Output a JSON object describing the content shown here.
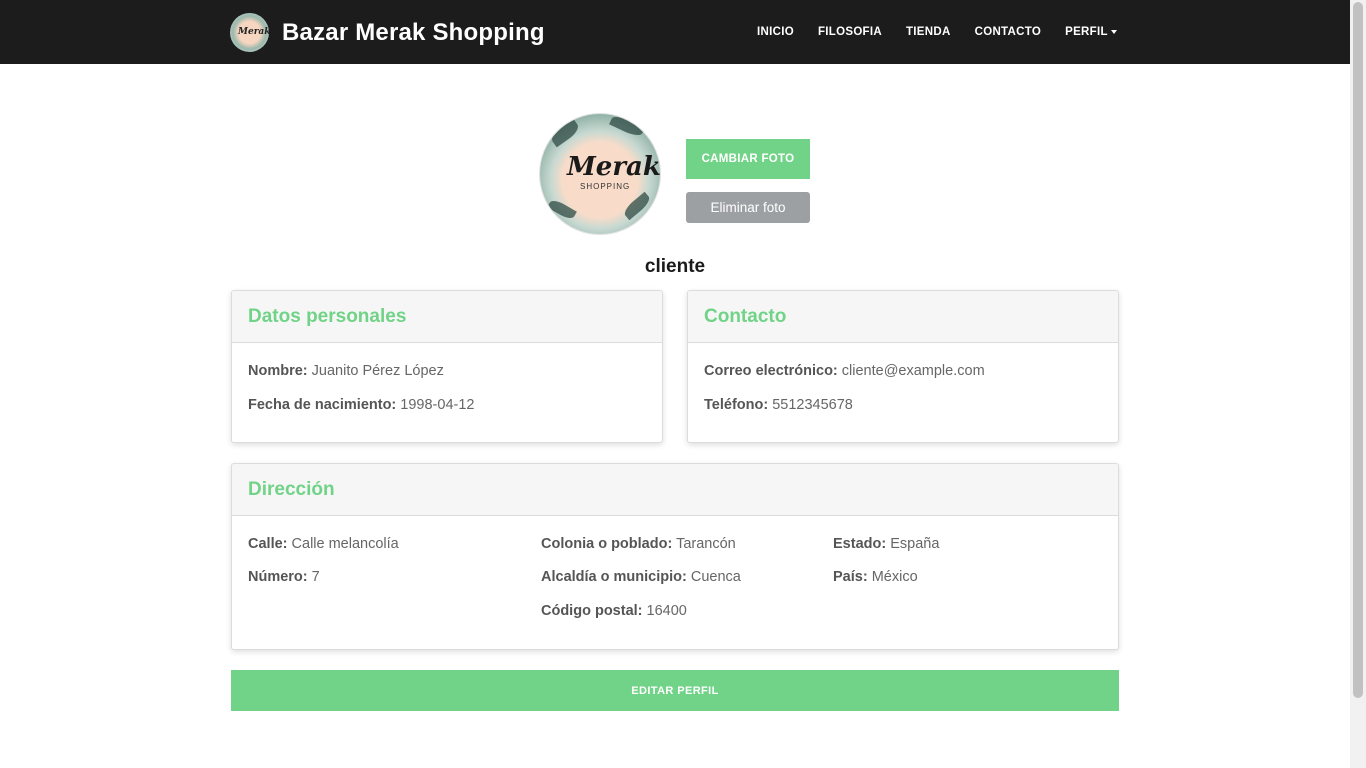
{
  "navbar": {
    "brand_name": "Bazar Merak Shopping",
    "links": [
      "INICIO",
      "FILOSOFIA",
      "TIENDA",
      "CONTACTO",
      "PERFIL"
    ]
  },
  "profile": {
    "change_photo": "CAMBIAR FOTO",
    "delete_photo": "Eliminar foto",
    "username": "cliente",
    "avatar_text": "Merak",
    "avatar_subtext": "SHOPPING"
  },
  "personal": {
    "title": "Datos personales",
    "name_label": "Nombre:",
    "name_value": "Juanito Pérez López",
    "birth_label": "Fecha de nacimiento:",
    "birth_value": "1998-04-12"
  },
  "contact": {
    "title": "Contacto",
    "email_label": "Correo electrónico:",
    "email_value": "cliente@example.com",
    "phone_label": "Teléfono:",
    "phone_value": "5512345678"
  },
  "address": {
    "title": "Dirección",
    "street_label": "Calle:",
    "street_value": "Calle melancolía",
    "number_label": "Número:",
    "number_value": "7",
    "colony_label": "Colonia o poblado:",
    "colony_value": "Tarancón",
    "municipality_label": "Alcaldía o municipio:",
    "municipality_value": "Cuenca",
    "zip_label": "Código postal:",
    "zip_value": "16400",
    "state_label": "Estado:",
    "state_value": "España",
    "country_label": "País:",
    "country_value": "México"
  },
  "actions": {
    "edit_profile": "EDITAR PERFIL"
  },
  "colors": {
    "accent": "#71d387",
    "navbar": "#1c1c1c",
    "secondary": "#9da0a3"
  }
}
